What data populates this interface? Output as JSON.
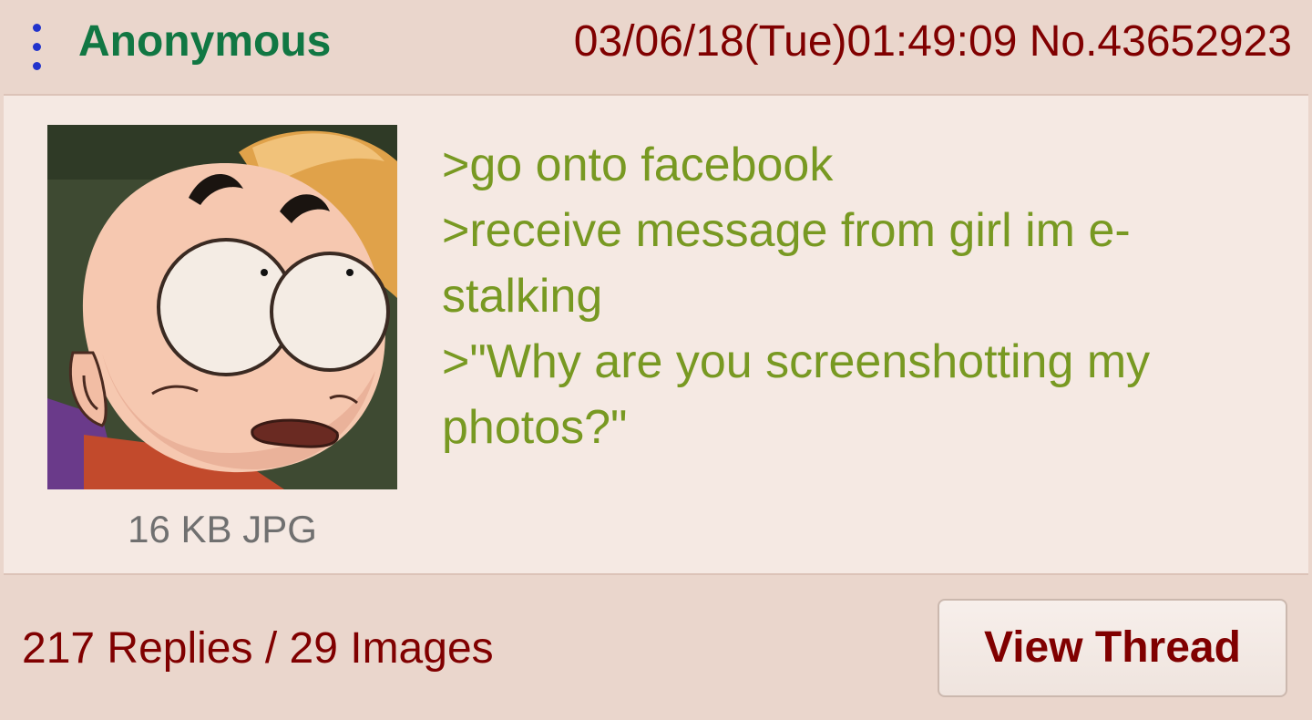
{
  "post": {
    "name": "Anonymous",
    "date": "03/06/18(Tue)01:49:09",
    "number": "No.43652923",
    "file_info": "16 KB JPG",
    "comment_lines": [
      ">go onto facebook",
      ">receive message from girl im e-",
      "stalking",
      ">\"Why are you screenshotting my",
      "photos?\""
    ]
  },
  "footer": {
    "reply_summary": "217 Replies / 29 Images",
    "view_thread_label": "View Thread"
  },
  "colors": {
    "name": "#117743",
    "meta": "#800000",
    "greentext": "#789922",
    "post_bg": "#f5e9e3",
    "page_bg": "#ead6cc",
    "menu": "#2233cc"
  },
  "icons": {
    "menu": "vertical-dots-icon"
  }
}
